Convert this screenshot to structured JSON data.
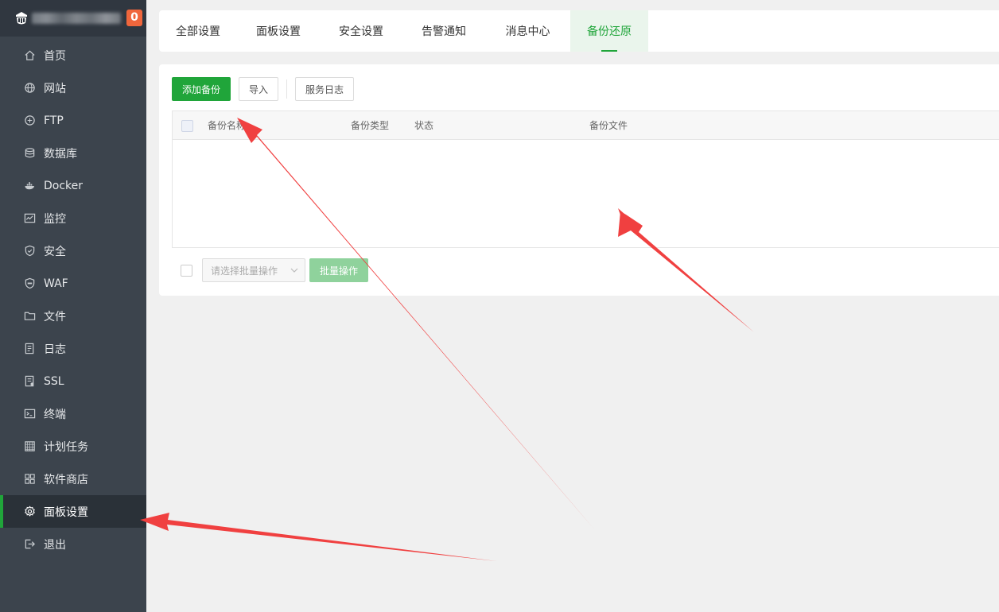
{
  "sidebar": {
    "badge": "0",
    "items": [
      {
        "label": "首页",
        "icon": "home-icon"
      },
      {
        "label": "网站",
        "icon": "globe-icon"
      },
      {
        "label": "FTP",
        "icon": "ftp-icon"
      },
      {
        "label": "数据库",
        "icon": "database-icon"
      },
      {
        "label": "Docker",
        "icon": "docker-icon"
      },
      {
        "label": "监控",
        "icon": "monitor-icon"
      },
      {
        "label": "安全",
        "icon": "shield-icon"
      },
      {
        "label": "WAF",
        "icon": "waf-icon"
      },
      {
        "label": "文件",
        "icon": "folder-icon"
      },
      {
        "label": "日志",
        "icon": "log-icon"
      },
      {
        "label": "SSL",
        "icon": "ssl-icon"
      },
      {
        "label": "终端",
        "icon": "terminal-icon"
      },
      {
        "label": "计划任务",
        "icon": "calendar-icon"
      },
      {
        "label": "软件商店",
        "icon": "apps-icon"
      },
      {
        "label": "面板设置",
        "icon": "gear-icon",
        "active": true
      },
      {
        "label": "退出",
        "icon": "logout-icon"
      }
    ]
  },
  "tabs": [
    {
      "label": "全部设置"
    },
    {
      "label": "面板设置"
    },
    {
      "label": "安全设置"
    },
    {
      "label": "告警通知"
    },
    {
      "label": "消息中心"
    },
    {
      "label": "备份还原",
      "active": true
    }
  ],
  "toolbar": {
    "add_backup": "添加备份",
    "import": "导入",
    "service_log": "服务日志"
  },
  "table": {
    "columns": [
      "备份名称",
      "备份类型",
      "状态",
      "备份文件"
    ]
  },
  "footer": {
    "select_placeholder": "请选择批量操作",
    "batch_button": "批量操作"
  },
  "colors": {
    "accent": "#20a53a",
    "sidebar_bg": "#3c444d",
    "badge": "#f0663c",
    "annotation_arrow": "#f04040"
  }
}
